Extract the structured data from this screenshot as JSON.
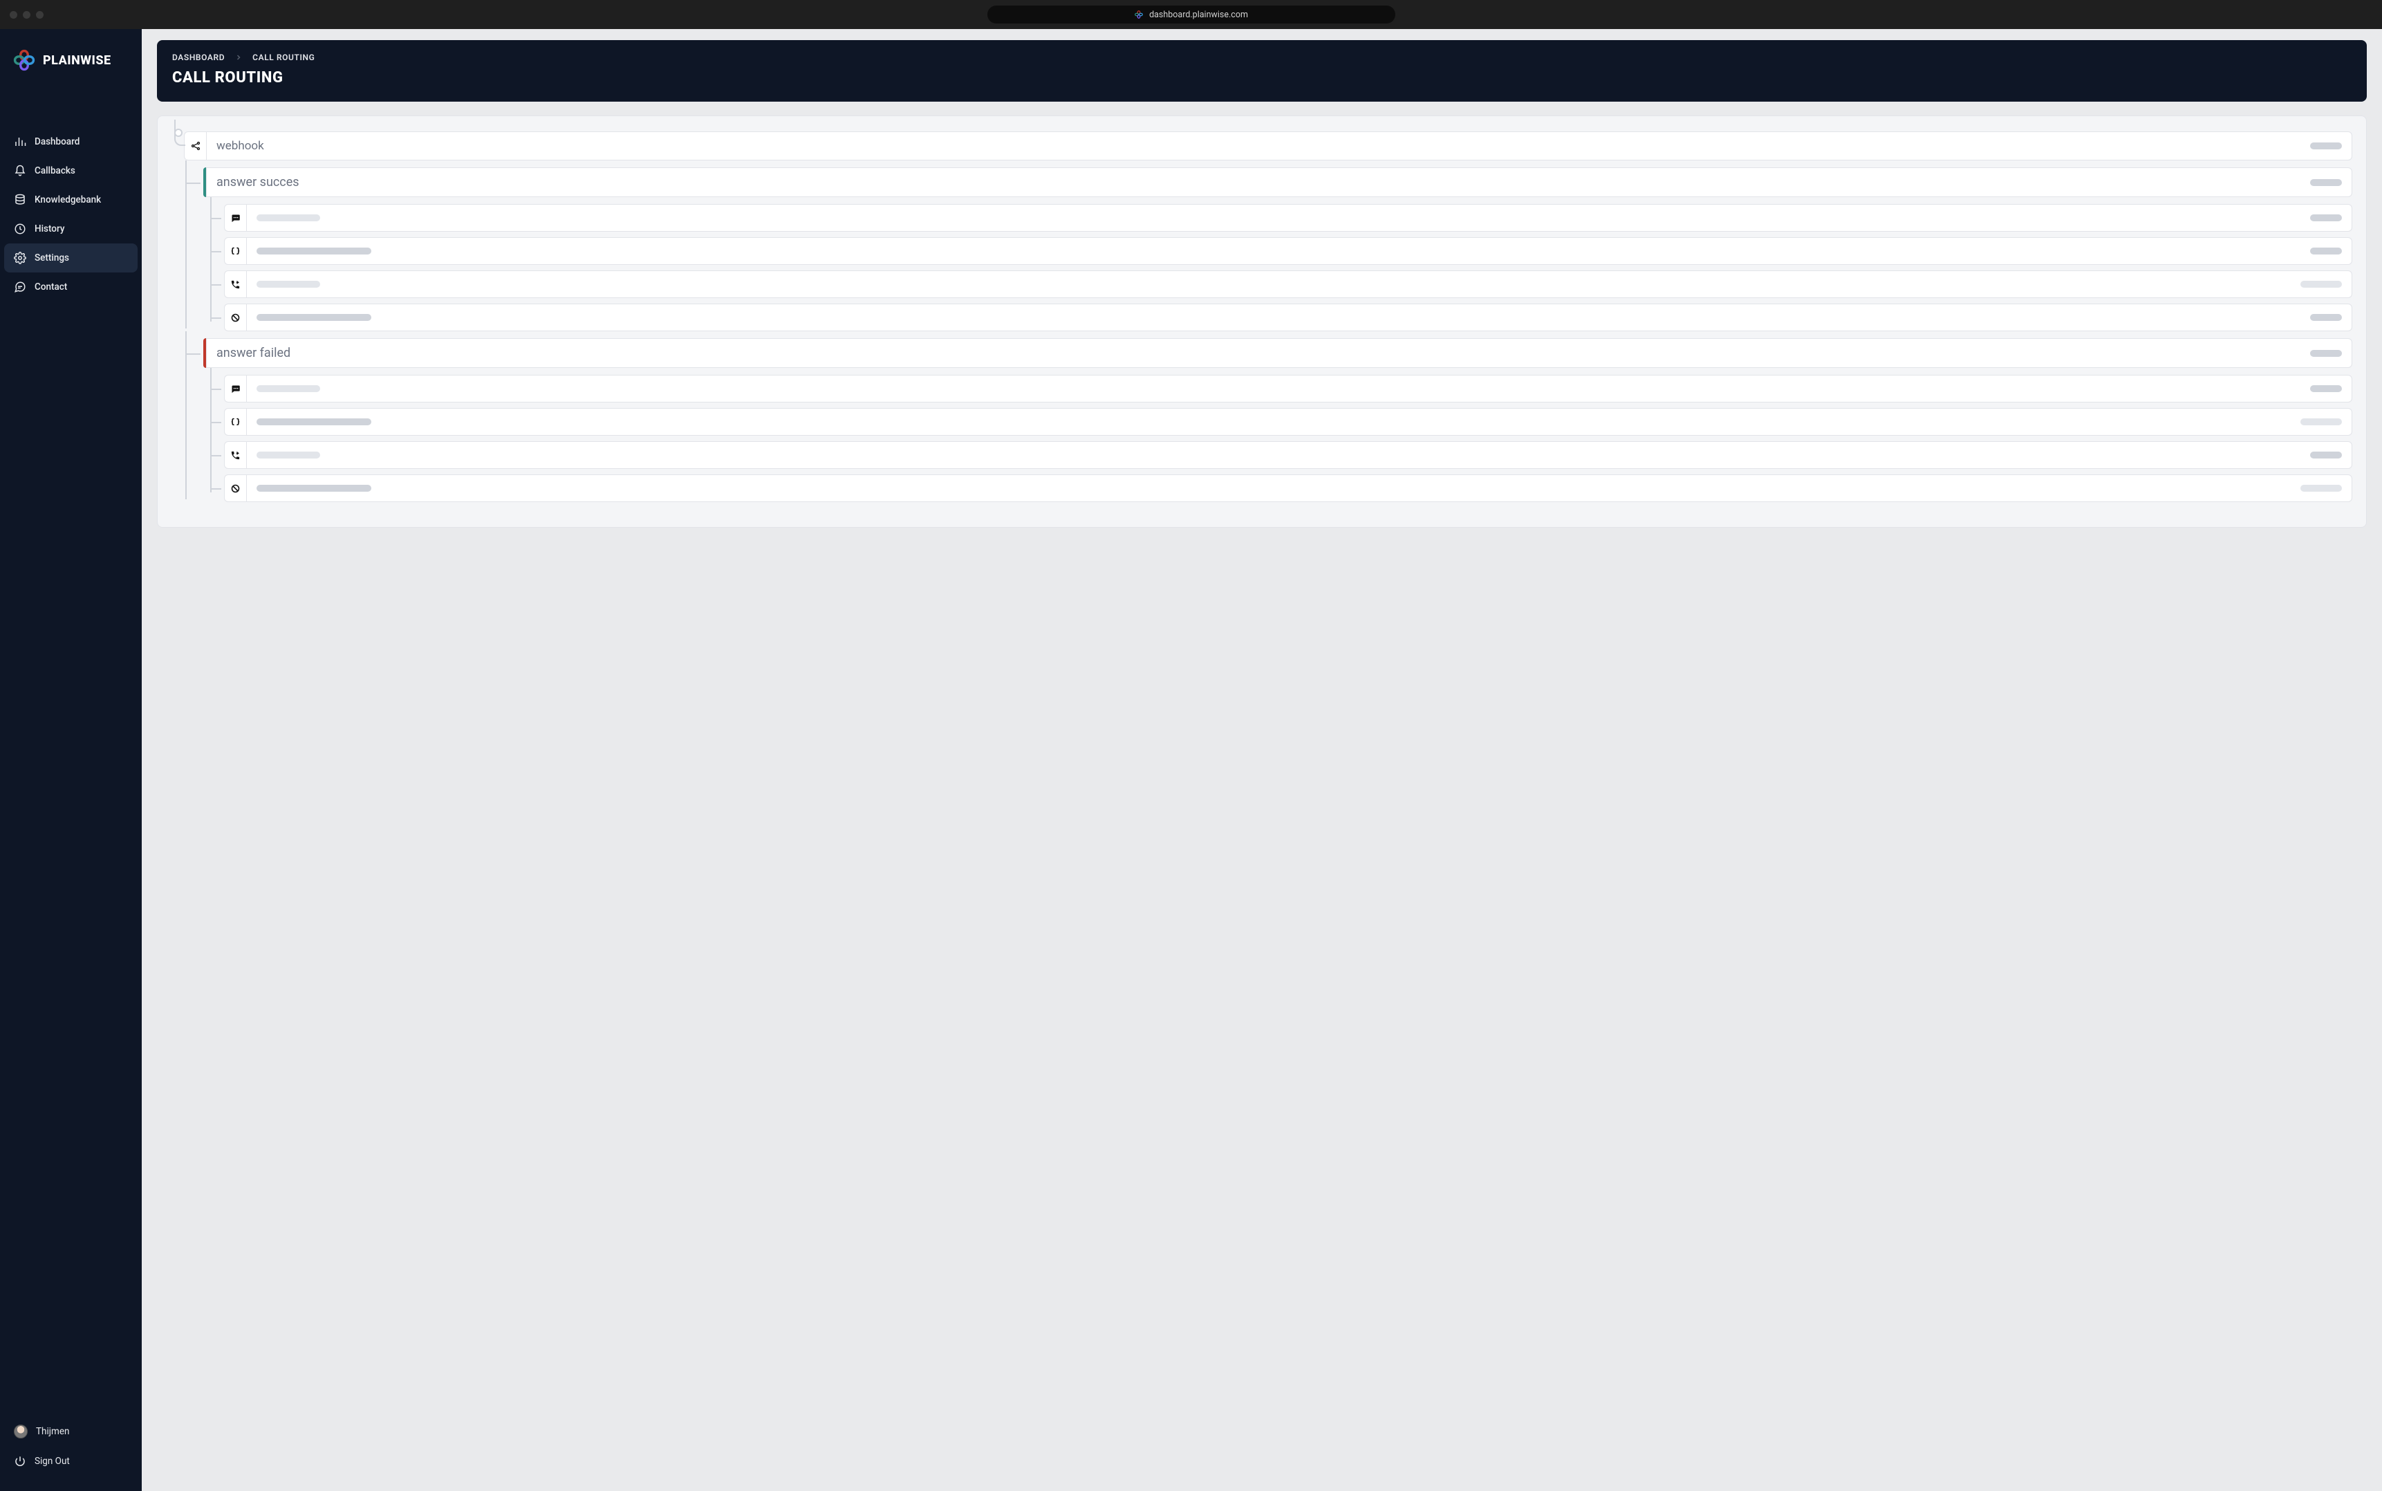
{
  "browser": {
    "url": "dashboard.plainwise.com"
  },
  "brand": {
    "name": "PLAINWISE"
  },
  "sidebar": {
    "items": [
      {
        "label": "Dashboard",
        "icon": "bar-chart-icon",
        "active": false
      },
      {
        "label": "Callbacks",
        "icon": "bell-icon",
        "active": false
      },
      {
        "label": "Knowledgebank",
        "icon": "database-icon",
        "active": false
      },
      {
        "label": "History",
        "icon": "clock-icon",
        "active": false
      },
      {
        "label": "Settings",
        "icon": "gear-icon",
        "active": true
      },
      {
        "label": "Contact",
        "icon": "chat-icon",
        "active": false
      }
    ]
  },
  "footer": {
    "user_name": "Thijmen",
    "signout_label": "Sign Out"
  },
  "breadcrumb": {
    "items": [
      "DASHBOARD",
      "CALL ROUTING"
    ]
  },
  "page": {
    "title": "CALL ROUTING"
  },
  "flow": {
    "root": {
      "label": "webhook",
      "icon": "share-icon"
    },
    "branches": [
      {
        "label": "answer succes",
        "accent": "green",
        "steps": [
          {
            "icon": "chat-bubble-icon",
            "left_w": "sm",
            "left_tone": "light",
            "right_w": "narrow",
            "right_tone": "dark"
          },
          {
            "icon": "code-braces-icon",
            "left_w": "md",
            "left_tone": "dark",
            "right_w": "narrow",
            "right_tone": "dark"
          },
          {
            "icon": "phone-forward-icon",
            "left_w": "sm",
            "left_tone": "light",
            "right_w": "wide",
            "right_tone": "light"
          },
          {
            "icon": "ban-icon",
            "left_w": "md",
            "left_tone": "dark",
            "right_w": "narrow",
            "right_tone": "dark"
          }
        ]
      },
      {
        "label": "answer failed",
        "accent": "red",
        "steps": [
          {
            "icon": "chat-bubble-icon",
            "left_w": "sm",
            "left_tone": "light",
            "right_w": "narrow",
            "right_tone": "dark"
          },
          {
            "icon": "code-braces-icon",
            "left_w": "md",
            "left_tone": "dark",
            "right_w": "wide",
            "right_tone": "light"
          },
          {
            "icon": "phone-forward-icon",
            "left_w": "sm",
            "left_tone": "light",
            "right_w": "narrow",
            "right_tone": "dark"
          },
          {
            "icon": "ban-icon",
            "left_w": "md",
            "left_tone": "dark",
            "right_w": "wide",
            "right_tone": "light"
          }
        ]
      }
    ]
  }
}
